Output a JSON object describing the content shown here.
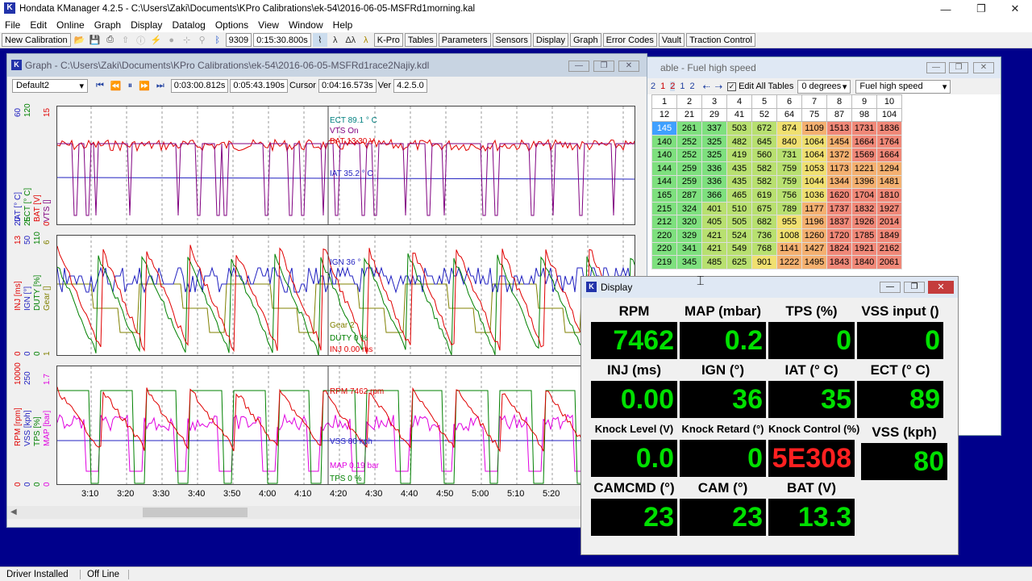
{
  "app": {
    "title": "Hondata KManager 4.2.5 - C:\\Users\\Zaki\\Documents\\KPro Calibrations\\ek-54\\2016-06-05-MSFRd1morning.kal"
  },
  "menu": [
    "File",
    "Edit",
    "Online",
    "Graph",
    "Display",
    "Datalog",
    "Options",
    "View",
    "Window",
    "Help"
  ],
  "toolbar": {
    "new_calibration": "New Calibration",
    "field1": "9309",
    "field2": "0:15:30.800s",
    "buttons": [
      "K-Pro",
      "Tables",
      "Parameters",
      "Sensors",
      "Display",
      "Graph",
      "Error Codes",
      "Vault",
      "Traction Control"
    ]
  },
  "graph": {
    "title": "Graph - C:\\Users\\Zaki\\Documents\\KPro Calibrations\\ek-54\\2016-06-05-MSFRd1race2Najiy.kdl",
    "preset": "Default2",
    "t1": "0:03:00.812s",
    "t2": "0:05:43.190s",
    "cursor_label": "Cursor",
    "cursor": "0:04:16.573s",
    "ver_label": "Ver",
    "ver": "4.2.5.0",
    "panel1": {
      "axis": [
        "IAT [° C]",
        "ECT [° C]",
        "BAT [V]",
        "VTS []"
      ],
      "top": [
        "60",
        "120",
        "15"
      ],
      "bot": [
        "20",
        "25",
        "0"
      ],
      "labels": {
        "ect": "ECT 89.1 ° C",
        "vts": "VTS On",
        "bat": "BAT 13.30 V",
        "iat": "IAT 35.2 ° C"
      }
    },
    "panel2": {
      "axis": [
        "INJ [ms]",
        "IGN [°]",
        "DUTY [%]",
        "Gear []"
      ],
      "top": [
        "13",
        "50",
        "110",
        "6"
      ],
      "bot": [
        "0",
        "0",
        "0",
        "1"
      ],
      "labels": {
        "ign": "IGN 36 °",
        "gear": "Gear 2",
        "duty": "DUTY 0 %",
        "inj": "INJ 0.00 ms"
      }
    },
    "panel3": {
      "axis": [
        "RPM [rpm]",
        "VSS [kph]",
        "TPS [%]",
        "MAP [bar]"
      ],
      "top": [
        "10000",
        "250",
        "1.7"
      ],
      "bot": [
        "0",
        "0",
        "0",
        "0"
      ],
      "labels": {
        "rpm": "RPM 7462 rpm",
        "vss": "VSS 80 kph",
        "map": "MAP 0.19 bar",
        "tps": "TPS 0 %"
      }
    },
    "xticks": [
      "3:10",
      "3:20",
      "3:30",
      "3:40",
      "3:50",
      "4:00",
      "4:10",
      "4:20",
      "4:30",
      "4:40",
      "4:50",
      "5:00",
      "5:10",
      "5:20"
    ]
  },
  "tablewin": {
    "title": "able - Fuel high speed",
    "edit_all": "Edit All Tables",
    "degrees": "0 degrees",
    "table": "Fuel high speed",
    "icons": [
      "2",
      "1",
      "2",
      "1",
      "2"
    ],
    "cols": [
      "1",
      "2",
      "3",
      "4",
      "5",
      "6",
      "7",
      "8",
      "9",
      "10"
    ],
    "hdr2": [
      "12",
      "21",
      "29",
      "41",
      "52",
      "64",
      "75",
      "87",
      "98",
      "104"
    ],
    "rows": [
      [
        "145",
        "261",
        "337",
        "503",
        "672",
        "874",
        "1109",
        "1513",
        "1731",
        "1836"
      ],
      [
        "140",
        "252",
        "325",
        "482",
        "645",
        "840",
        "1064",
        "1454",
        "1664",
        "1764"
      ],
      [
        "140",
        "252",
        "325",
        "419",
        "560",
        "731",
        "1064",
        "1372",
        "1569",
        "1664"
      ],
      [
        "144",
        "259",
        "336",
        "435",
        "582",
        "759",
        "1053",
        "1173",
        "1221",
        "1294"
      ],
      [
        "144",
        "259",
        "336",
        "435",
        "582",
        "759",
        "1044",
        "1344",
        "1396",
        "1481"
      ],
      [
        "165",
        "287",
        "366",
        "465",
        "619",
        "756",
        "1036",
        "1620",
        "1704",
        "1810"
      ],
      [
        "215",
        "324",
        "401",
        "510",
        "675",
        "789",
        "1177",
        "1737",
        "1832",
        "1927"
      ],
      [
        "212",
        "320",
        "405",
        "505",
        "682",
        "955",
        "1196",
        "1837",
        "1926",
        "2014"
      ],
      [
        "220",
        "329",
        "421",
        "524",
        "736",
        "1008",
        "1260",
        "1720",
        "1785",
        "1849"
      ],
      [
        "220",
        "341",
        "421",
        "549",
        "768",
        "1141",
        "1427",
        "1824",
        "1921",
        "2162"
      ],
      [
        "219",
        "345",
        "485",
        "625",
        "901",
        "1222",
        "1495",
        "1843",
        "1840",
        "2061"
      ]
    ]
  },
  "display": {
    "title": "Display",
    "cells": [
      {
        "label": "RPM",
        "value": "7462"
      },
      {
        "label": "MAP (mbar)",
        "value": "0.2"
      },
      {
        "label": "TPS (%)",
        "value": "0"
      },
      {
        "label": "VSS input ()",
        "value": "0"
      },
      {
        "label": "INJ (ms)",
        "value": "0.00"
      },
      {
        "label": "IGN (°)",
        "value": "36"
      },
      {
        "label": "IAT (° C)",
        "value": "35"
      },
      {
        "label": "ECT (° C)",
        "value": "89"
      },
      {
        "label": "Knock Level (V)",
        "value": "0.0"
      },
      {
        "label": "Knock Retard (°)",
        "value": "0"
      },
      {
        "label": "Knock Control (%)",
        "value": "5E308"
      },
      {
        "label": "VSS (kph)",
        "value": "80"
      },
      {
        "label": "CAMCMD (°)",
        "value": "23"
      },
      {
        "label": "CAM (°)",
        "value": "23"
      },
      {
        "label": "BAT (V)",
        "value": "13.3"
      }
    ]
  },
  "status": {
    "driver": "Driver Installed",
    "line": "Off Line"
  },
  "colors": {
    "desktop": "#00008b",
    "red": "#e00000",
    "green": "#008000",
    "blue": "#2020c0",
    "purple": "#800080",
    "olive": "#808000",
    "magenta": "#e000e0"
  }
}
